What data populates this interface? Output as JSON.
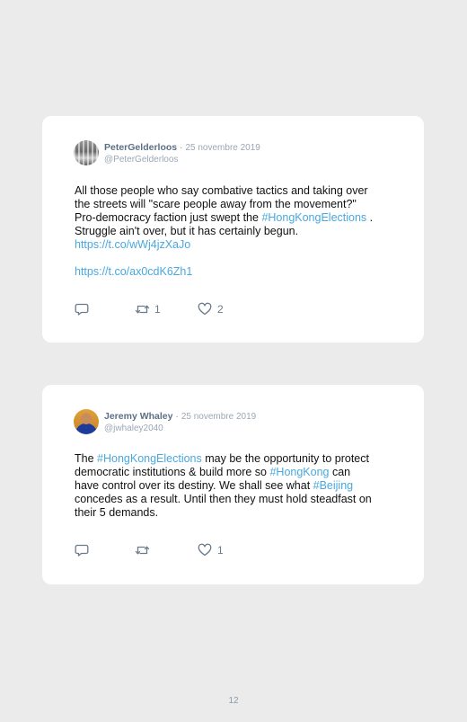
{
  "tweets": [
    {
      "author": "PeterGelderloos",
      "separator": "·",
      "date": "25 novembre 2019",
      "handle": "@PeterGelderloos",
      "avatar_icon": "avatar-photo",
      "text": {
        "line1": "All those people who say combative tactics and taking over",
        "line2": "the streets will \"scare people away from the movement?\"",
        "line3_pre": "Pro-democracy faction just swept the ",
        "hashtag1": "#HongKongElections",
        "line3_post": " .",
        "line4": "Struggle ain't over, but it has certainly begun.",
        "link1": "https://t.co/wWj4jzXaJo",
        "link2": "https://t.co/ax0cdK6Zh1"
      },
      "actions": {
        "reply_icon": "reply-icon",
        "retweet_icon": "retweet-icon",
        "retweet_count": "1",
        "like_icon": "heart-icon",
        "like_count": "2"
      }
    },
    {
      "author": "Jeremy Whaley",
      "separator": "·",
      "date": "25 novembre 2019",
      "handle": "@jwhaley2040",
      "avatar_icon": "avatar-photo",
      "text": {
        "pre1": "The ",
        "hashtag1": "#HongKongElections",
        "post1": " may be the opportunity to protect",
        "line2_pre": "democratic institutions & build more so ",
        "hashtag2": "#HongKong",
        "line2_post": " can",
        "line3_pre": "have control over its destiny. We shall see what ",
        "hashtag3": "#Beijing",
        "line4": "concedes as a result. Until then they must hold steadfast on",
        "line5": "their 5 demands."
      },
      "actions": {
        "reply_icon": "reply-icon",
        "retweet_icon": "retweet-icon",
        "retweet_count": "",
        "like_icon": "heart-icon",
        "like_count": "1"
      }
    }
  ],
  "page_number": "12",
  "colors": {
    "background": "#ebebeb",
    "card": "#ffffff",
    "link": "#49a8de",
    "author": "#5c6f84",
    "meta": "#9aa7b5",
    "body": "#111111"
  }
}
